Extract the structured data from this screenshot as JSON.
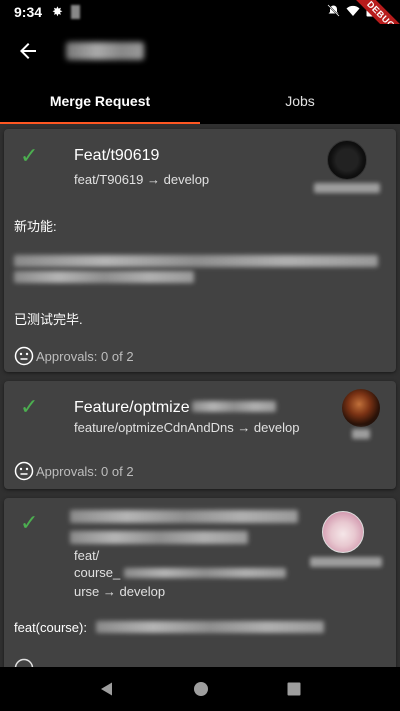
{
  "status_bar": {
    "time": "9:34",
    "debug_label": "DEBUG"
  },
  "app_bar": {
    "title": ""
  },
  "tabs": [
    {
      "label": "Merge Request",
      "active": true
    },
    {
      "label": "Jobs",
      "active": false
    }
  ],
  "merge_requests": [
    {
      "title": "Feat/t90619",
      "branch": "feat/T90619 → develop",
      "description_heading": "新功能:",
      "description_footer": "已测试完毕.",
      "approvals": "Approvals: 0 of 2"
    },
    {
      "title": "Feature/optmize",
      "branch": "feature/optmizeCdnAndDns → develop",
      "approvals": "Approvals: 0 of 2"
    },
    {
      "branch_line1": "feat/",
      "branch_line2": "course_",
      "branch_line3": "urse → develop",
      "description_prefix": "feat(course):"
    }
  ],
  "colors": {
    "accent": "#ff5722",
    "check": "#4caf50",
    "card": "#424242",
    "background": "#303030"
  }
}
